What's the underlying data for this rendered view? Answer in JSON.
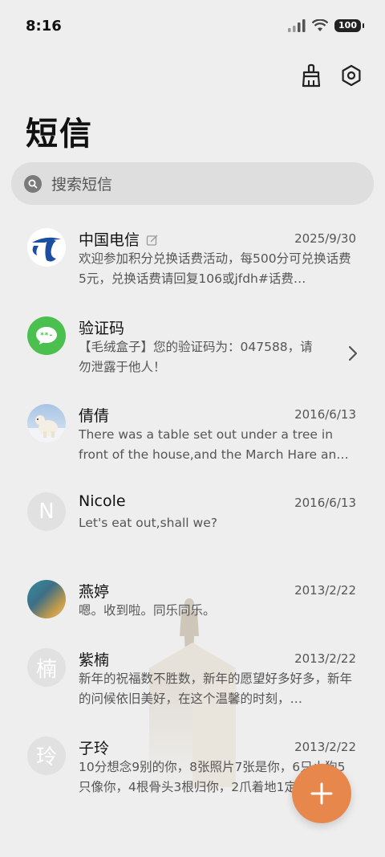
{
  "status": {
    "time": "8:16",
    "battery": "100"
  },
  "page_title": "短信",
  "search": {
    "placeholder": "搜索短信"
  },
  "conversations": [
    {
      "name": "中国电信",
      "date": "2025/9/30",
      "snippet": "欢迎参加积分兑换话费活动，每500分可兑换话费5元，兑换话费请回复106或jfdh#话费…",
      "avatar_icon": "china-telecom-logo"
    },
    {
      "name": "验证码",
      "date": "",
      "snippet": "【毛绒盒子】您的验证码为：047588，请勿泄露于他人！",
      "avatar_icon": "message-bubble-icon"
    },
    {
      "name": "倩倩",
      "date": "2016/6/13",
      "snippet": "There was a table set out under a tree in front of the house,and the March Hare an…",
      "avatar_icon": "polar-bear-photo"
    },
    {
      "name": "Nicole",
      "date": "2016/6/13",
      "snippet": "Let's eat out,shall we?",
      "avatar_letter": "N"
    },
    {
      "name": "燕婷",
      "date": "2013/2/22",
      "snippet": "嗯。收到啦。同乐同乐。",
      "avatar_icon": "landscape-photo"
    },
    {
      "name": "紫楠",
      "date": "2013/2/22",
      "snippet": "新年的祝福数不胜数，新年的愿望好多好多，新年的问候依旧美好，在这个温馨的时刻，…",
      "avatar_letter": "楠"
    },
    {
      "name": "子玲",
      "date": "2013/2/22",
      "snippet": "10分想念9别的你，8张照片7张是你，6只小狗5只像你，4根骨头3根归你，2爪着地1定…",
      "avatar_letter": "玲"
    }
  ],
  "colors": {
    "fab": "#e8874b",
    "verify_green": "#4cc04f",
    "telecom_blue": "#1a4ea0"
  },
  "icons": {
    "clean": "broom-icon",
    "settings": "settings-icon",
    "fab": "plus-icon"
  }
}
